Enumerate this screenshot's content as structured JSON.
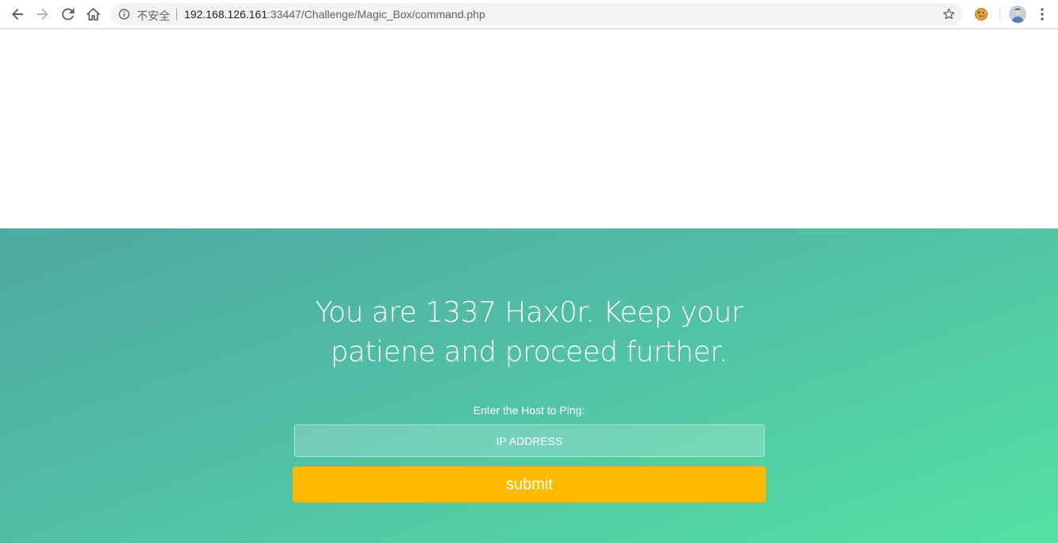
{
  "browser": {
    "security_label": "不安全",
    "url_host": "192.168.126.161",
    "url_rest": ":33447/Challenge/Magic_Box/command.php"
  },
  "page": {
    "headline_line1": "You are 1337 Hax0r. Keep your",
    "headline_line2": "patiene and proceed further.",
    "form": {
      "label": "Enter the Host to Ping:",
      "input_placeholder": "IP ADDRESS",
      "input_value": "",
      "submit_label": "submit"
    }
  },
  "colors": {
    "gradient_start": "#50a8a2",
    "gradient_end": "#53e2a3",
    "submit_bg": "#ffbb00"
  },
  "icons": [
    "back-icon",
    "forward-icon",
    "reload-icon",
    "home-icon",
    "info-icon",
    "bookmark-star-icon",
    "cookie-extension-icon",
    "profile-avatar",
    "more-menu-icon"
  ]
}
